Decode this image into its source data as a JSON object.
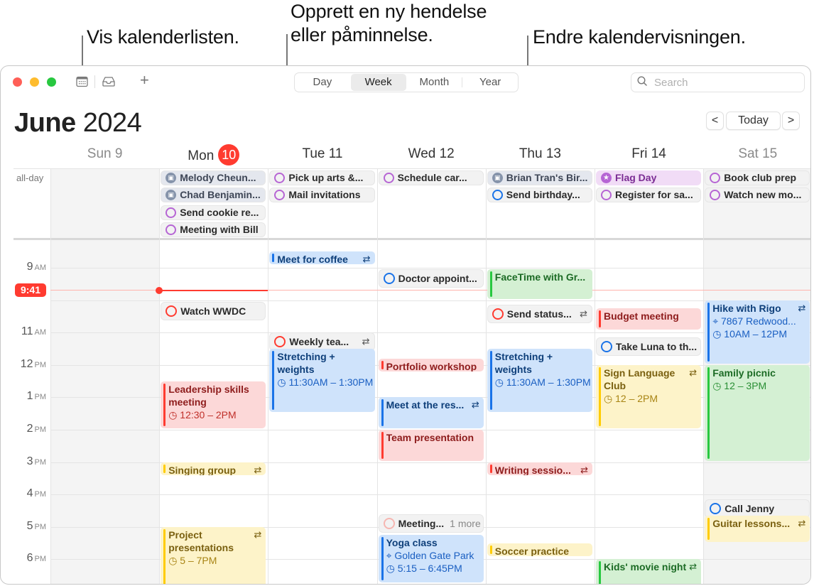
{
  "callouts": {
    "calendar_list": "Vis kalenderlisten.",
    "new_event_line1": "Opprett en ny hendelse",
    "new_event_line2": "eller påminnelse.",
    "change_view": "Endre kalendervisningen."
  },
  "toolbar": {
    "calendar_list_icon": "calendar-grid-icon",
    "inbox_icon": "inbox-tray-icon",
    "add_label": "+",
    "views": [
      "Day",
      "Week",
      "Month",
      "Year"
    ],
    "active_view": "Week",
    "search_placeholder": "Search"
  },
  "header": {
    "month": "June",
    "year": "2024",
    "prev_label": "<",
    "today_label": "Today",
    "next_label": ">"
  },
  "days": [
    {
      "label": "Sun 9",
      "weekend": true
    },
    {
      "label": "Mon",
      "badge": "10",
      "today": true
    },
    {
      "label": "Tue 11"
    },
    {
      "label": "Wed 12"
    },
    {
      "label": "Thu 13"
    },
    {
      "label": "Fri 14"
    },
    {
      "label": "Sat 15",
      "weekend": true
    }
  ],
  "allday_label": "all-day",
  "allday_events": [
    {
      "day": 1,
      "row": 0,
      "title": "Melody Cheun...",
      "kind": "birthday"
    },
    {
      "day": 1,
      "row": 1,
      "title": "Chad Benjamin...",
      "kind": "birthday"
    },
    {
      "day": 1,
      "row": 2,
      "title": "Send cookie re...",
      "kind": "reminder"
    },
    {
      "day": 1,
      "row": 3,
      "title": "Meeting with Bill",
      "kind": "reminder"
    },
    {
      "day": 2,
      "row": 0,
      "title": "Pick up arts &...",
      "kind": "reminder"
    },
    {
      "day": 2,
      "row": 1,
      "title": "Mail invitations",
      "kind": "reminder"
    },
    {
      "day": 3,
      "row": 0,
      "title": "Schedule car...",
      "kind": "reminder"
    },
    {
      "day": 4,
      "row": 0,
      "title": "Brian Tran's Bir...",
      "kind": "birthday"
    },
    {
      "day": 4,
      "row": 1,
      "title": "Send birthday...",
      "kind": "reminder-blue"
    },
    {
      "day": 5,
      "row": 0,
      "title": "Flag Day",
      "kind": "holiday"
    },
    {
      "day": 5,
      "row": 1,
      "title": "Register for sa...",
      "kind": "reminder"
    },
    {
      "day": 6,
      "row": 0,
      "title": "Book club prep",
      "kind": "reminder"
    },
    {
      "day": 6,
      "row": 1,
      "title": "Watch new mo...",
      "kind": "reminder"
    }
  ],
  "hours": [
    {
      "h": 9,
      "label": "9",
      "ampm": "AM"
    },
    {
      "h": 10,
      "label": "",
      "ampm": ""
    },
    {
      "h": 11,
      "label": "11",
      "ampm": "AM"
    },
    {
      "h": 12,
      "label": "12",
      "ampm": "PM"
    },
    {
      "h": 13,
      "label": "1",
      "ampm": "PM"
    },
    {
      "h": 14,
      "label": "2",
      "ampm": "PM"
    },
    {
      "h": 15,
      "label": "3",
      "ampm": "PM"
    },
    {
      "h": 16,
      "label": "4",
      "ampm": "PM"
    },
    {
      "h": 17,
      "label": "5",
      "ampm": "PM"
    },
    {
      "h": 18,
      "label": "6",
      "ampm": "PM"
    }
  ],
  "now": {
    "label": "9:41",
    "hour": 9.683
  },
  "colors": {
    "today_red": "#ff3b30",
    "blue": "#1a73e8",
    "green": "#28c840",
    "yellow": "#ffcc00",
    "purple": "#b665d4"
  },
  "timed_events": [
    {
      "day": 2,
      "start": 8.5,
      "end": 8.9,
      "title": "Meet for coffee",
      "color": "blue",
      "repeat": true
    },
    {
      "day": 3,
      "start": 9.05,
      "end": 9.6,
      "title": "Doctor appoint...",
      "type": "reminder",
      "ring": "blue"
    },
    {
      "day": 4,
      "start": 9.05,
      "end": 10.0,
      "title": "FaceTime with Gr...",
      "color": "green"
    },
    {
      "day": 1,
      "start": 10.05,
      "end": 10.6,
      "title": "Watch WWDC",
      "type": "reminder",
      "ring": "red"
    },
    {
      "day": 4,
      "start": 10.15,
      "end": 10.7,
      "title": "Send status...",
      "type": "reminder",
      "ring": "red",
      "repeat": true
    },
    {
      "day": 5,
      "start": 10.25,
      "end": 10.95,
      "title": "Budget meeting",
      "color": "red"
    },
    {
      "day": 5,
      "start": 11.15,
      "end": 11.7,
      "title": "Take Luna to th...",
      "type": "reminder",
      "ring": "blue"
    },
    {
      "day": 6,
      "start": 10.0,
      "end": 12.0,
      "title": "Hike with Rigo",
      "color": "blue",
      "repeat": true,
      "location": "7867 Redwood...",
      "time": "10AM – 12PM"
    },
    {
      "day": 2,
      "start": 11.0,
      "end": 11.5,
      "title": "Weekly tea...",
      "type": "reminder",
      "ring": "red",
      "repeat": true
    },
    {
      "day": 2,
      "start": 11.5,
      "end": 13.5,
      "title": "Stretching + weights",
      "color": "blue",
      "time": "11:30AM – 1:30PM"
    },
    {
      "day": 4,
      "start": 11.5,
      "end": 13.5,
      "title": "Stretching + weights",
      "color": "blue",
      "time": "11:30AM – 1:30PM"
    },
    {
      "day": 3,
      "start": 11.8,
      "end": 12.2,
      "title": "Portfolio workshop",
      "color": "red"
    },
    {
      "day": 5,
      "start": 12.0,
      "end": 14.0,
      "title": "Sign Language Club",
      "color": "yellow",
      "repeat": true,
      "time": "12 – 2PM"
    },
    {
      "day": 6,
      "start": 12.0,
      "end": 15.0,
      "title": "Family picnic",
      "color": "green",
      "time": "12 – 3PM"
    },
    {
      "day": 1,
      "start": 12.5,
      "end": 14.0,
      "title": "Leadership skills meeting",
      "color": "red",
      "time": "12:30 – 2PM"
    },
    {
      "day": 3,
      "start": 13.0,
      "end": 14.0,
      "title": "Meet at the res...",
      "color": "blue",
      "repeat": true
    },
    {
      "day": 3,
      "start": 14.0,
      "end": 15.0,
      "title": "Team presentation",
      "color": "red"
    },
    {
      "day": 1,
      "start": 15.0,
      "end": 15.45,
      "title": "Singing group",
      "color": "yellow",
      "repeat": true
    },
    {
      "day": 4,
      "start": 15.0,
      "end": 15.45,
      "title": "Writing sessio...",
      "color": "red",
      "repeat": true
    },
    {
      "day": 6,
      "start": 16.15,
      "end": 16.65,
      "title": "Call Jenny",
      "type": "reminder",
      "ring": "blue"
    },
    {
      "day": 6,
      "start": 16.65,
      "end": 17.5,
      "title": "Guitar lessons...",
      "color": "yellow",
      "repeat": true
    },
    {
      "day": 3,
      "start": 16.6,
      "end": 17.25,
      "title": "Meeting...",
      "type": "reminder",
      "ring": "faint",
      "more": "1 more"
    },
    {
      "day": 3,
      "start": 17.25,
      "end": 18.75,
      "title": "Yoga class",
      "color": "blue",
      "location": "Golden Gate Park",
      "time": "5:15 – 6:45PM"
    },
    {
      "day": 1,
      "start": 17.0,
      "end": 19.0,
      "title": "Project presentations",
      "color": "yellow",
      "repeat": true,
      "time": "5 – 7PM"
    },
    {
      "day": 4,
      "start": 17.5,
      "end": 17.95,
      "title": "Soccer practice",
      "color": "yellow"
    },
    {
      "day": 5,
      "start": 18.0,
      "end": 19.0,
      "title": "Kids' movie night",
      "color": "green",
      "repeat": true
    }
  ]
}
